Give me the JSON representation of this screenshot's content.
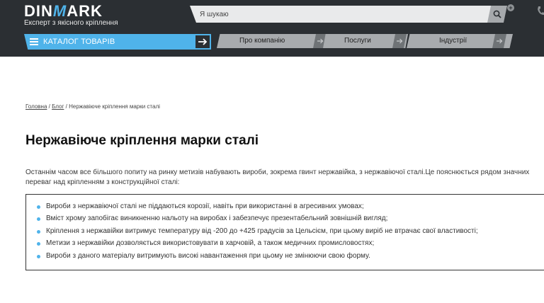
{
  "header": {
    "logo_left": "DIN",
    "logo_mark": "M",
    "logo_right": "ARK",
    "tagline": "Експерт з якісного кріплення",
    "search_placeholder": "Я шукаю"
  },
  "nav": {
    "catalog_label": "КАТАЛОГ ТОВАРІВ",
    "items": [
      {
        "label": "Про компанію"
      },
      {
        "label": "Послуги"
      },
      {
        "label": "Індустрії"
      }
    ]
  },
  "breadcrumb": {
    "home": "Головна",
    "sep1": "/",
    "blog": "Блог",
    "sep2": "/",
    "current": "Нержавіюче кріплення марки сталі"
  },
  "article": {
    "title": "Нержавіюче кріплення марки сталі",
    "intro_line1": "Останнім часом все більшого попиту на ринку метизів набувають вироби, зокрема гвинт нержавійка, з нержавіючої сталі.Це пояснюється рядом значних",
    "intro_line2": "переваг над кріпленням з конструкційної сталі:",
    "bullets": [
      "Вироби з нержавіючої сталі не піддаються корозії, навіть при використанні в агресивних умовах;",
      "Вміст хрому запобігає виникненню нальоту на виробах і забезпечує презентабельний зовнішній вигляд;",
      "Кріплення з нержавійки витримує температуру від -200 до +425 градусів за Цельсієм, при цьому виріб не втрачає свої властивості;",
      "Метизи з нержавійки дозволяється використовувати в харчовій, а також медичних промисловостях;",
      "Вироби з даного матеріалу витримують високі навантаження при цьому не змінюючи свою форму."
    ]
  },
  "colors": {
    "header_bg": "#2b2f33",
    "accent": "#4fb3ea",
    "nav_item_bg": "#a8abae"
  }
}
